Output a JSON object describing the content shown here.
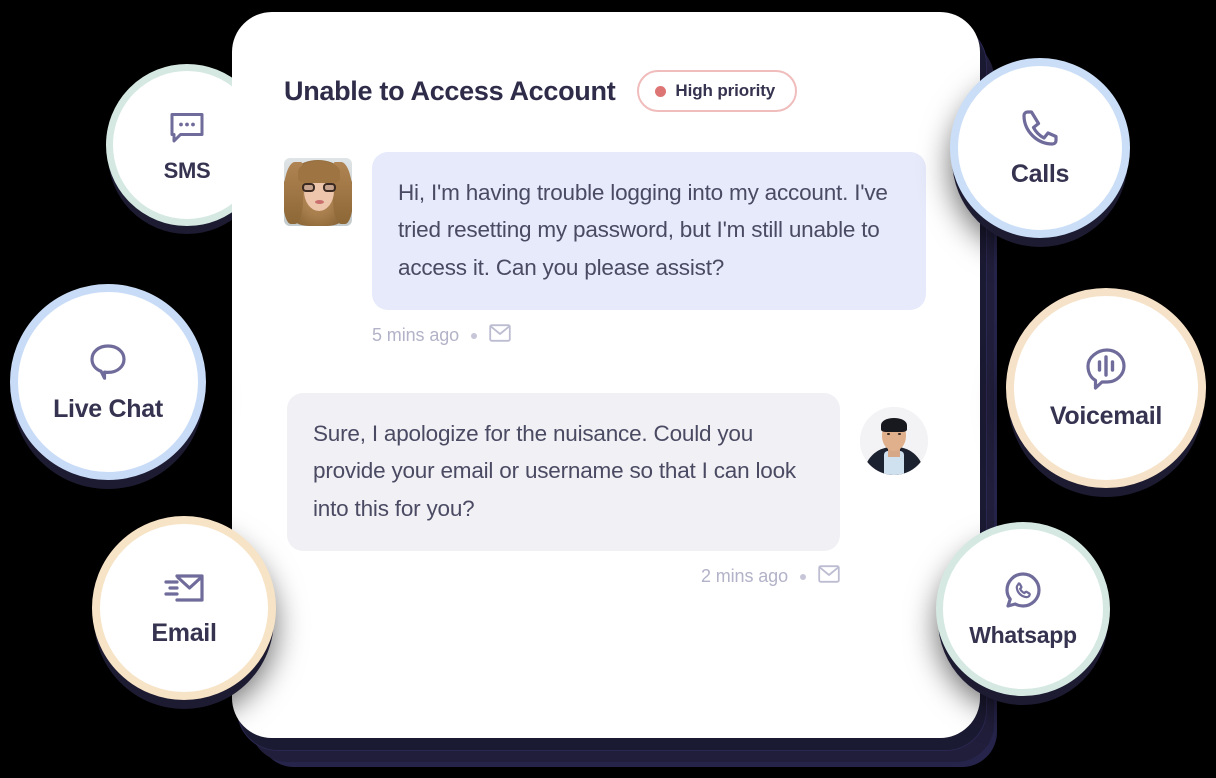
{
  "theme": {
    "background": "#000000",
    "card_background": "#ffffff",
    "card_shadow": "#1d1b32",
    "text_primary": "#2e2c48",
    "text_body": "#4a4a63",
    "text_muted": "#b2b2c8",
    "icon_purple": "#6f6b9a",
    "bubble_customer": "#e6eafb",
    "bubble_agent": "#f1f0f5",
    "priority_border": "#f0bcbc",
    "priority_dot": "#de7575",
    "ring_mint": "#d5e9e2",
    "ring_blue": "#c9dcf7",
    "ring_cream": "#f7e3c6"
  },
  "conversation": {
    "title": "Unable to Access Account",
    "priority": {
      "label": "High priority",
      "dot_icon": "priority-dot-icon"
    },
    "messages": [
      {
        "sender": "customer",
        "avatar_icon": "customer-avatar",
        "text": "Hi, I'm having trouble logging into my account. I've tried resetting my password, but I'm still unable to access it. Can you please assist?",
        "timestamp": "5 mins ago",
        "separator": "•",
        "channel_icon": "envelope-icon"
      },
      {
        "sender": "agent",
        "avatar_icon": "agent-avatar",
        "text": "Sure, I apologize for the nuisance. Could you provide your email or username so that I can look into this for you?",
        "timestamp": "2 mins ago",
        "separator": "•",
        "channel_icon": "envelope-icon"
      }
    ]
  },
  "channels": [
    {
      "id": "sms",
      "label": "SMS",
      "icon": "sms-bubble-icon",
      "ring_color": "#d5e9e2"
    },
    {
      "id": "livechat",
      "label": "Live Chat",
      "icon": "chat-bubble-icon",
      "ring_color": "#c9dcf7"
    },
    {
      "id": "email",
      "label": "Email",
      "icon": "envelope-send-icon",
      "ring_color": "#f7e3c6"
    },
    {
      "id": "calls",
      "label": "Calls",
      "icon": "phone-icon",
      "ring_color": "#cadef8"
    },
    {
      "id": "voicemail",
      "label": "Voicemail",
      "icon": "voicemail-wave-icon",
      "ring_color": "#f6e2c8"
    },
    {
      "id": "whatsapp",
      "label": "Whatsapp",
      "icon": "whatsapp-icon",
      "ring_color": "#d5e9e2"
    }
  ]
}
